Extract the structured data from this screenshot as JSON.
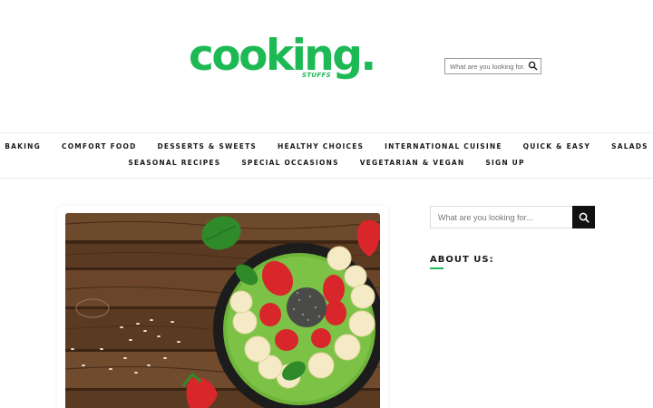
{
  "brand": {
    "name": "cooking.",
    "sub": "STUFFS",
    "color": "#1db954"
  },
  "header_search": {
    "placeholder": "What are you looking for..",
    "icon": "search-icon"
  },
  "nav": {
    "row1": [
      "BAKING",
      "COMFORT FOOD",
      "DESSERTS & SWEETS",
      "HEALTHY CHOICES",
      "INTERNATIONAL CUISINE",
      "QUICK & EASY",
      "SALADS"
    ],
    "row2": [
      "SEASONAL RECIPES",
      "SPECIAL OCCASIONS",
      "VEGETARIAN & VEGAN",
      "SIGN UP"
    ]
  },
  "featured_image": {
    "subject": "smoothie bowl with strawberries, banana slices and chia seeds on wooden table"
  },
  "sidebar": {
    "search_placeholder": "What are you looking for...",
    "search_icon": "search-icon",
    "about_title": "ABOUT US:"
  }
}
